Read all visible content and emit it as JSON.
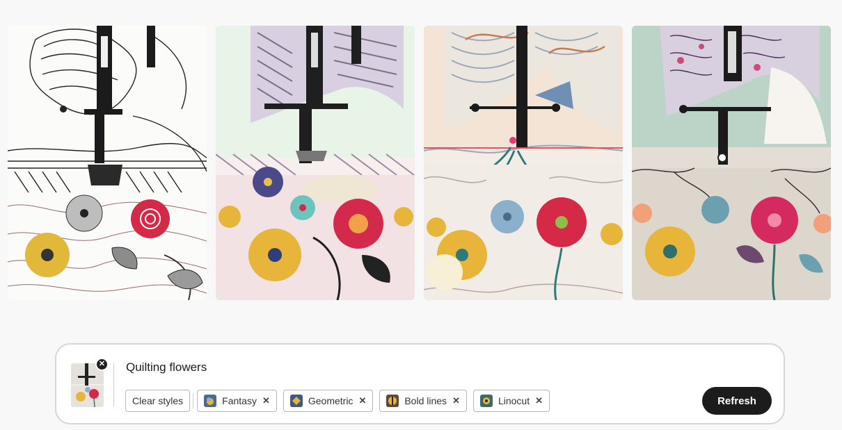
{
  "gallery": {
    "images": [
      {
        "name": "generated-image-1",
        "style": "line-art"
      },
      {
        "name": "generated-image-2",
        "style": "pastel"
      },
      {
        "name": "generated-image-3",
        "style": "embroidery"
      },
      {
        "name": "generated-image-4",
        "style": "vintage"
      }
    ]
  },
  "prompt": {
    "text": "Quilting flowers",
    "remove_icon": "close-icon",
    "clear_label": "Clear styles",
    "styles": [
      {
        "label": "Fantasy",
        "color": "#6f8fb5"
      },
      {
        "label": "Geometric",
        "color": "#c9a227"
      },
      {
        "label": "Bold lines",
        "color": "#8a6b3a"
      },
      {
        "label": "Linocut",
        "color": "#5a8a8f"
      }
    ],
    "refresh_label": "Refresh"
  },
  "colors": {
    "accent": "#1c1c1c",
    "red_flower": "#d42a48",
    "yellow_flower": "#e6b53a",
    "teal": "#2f7a78"
  }
}
